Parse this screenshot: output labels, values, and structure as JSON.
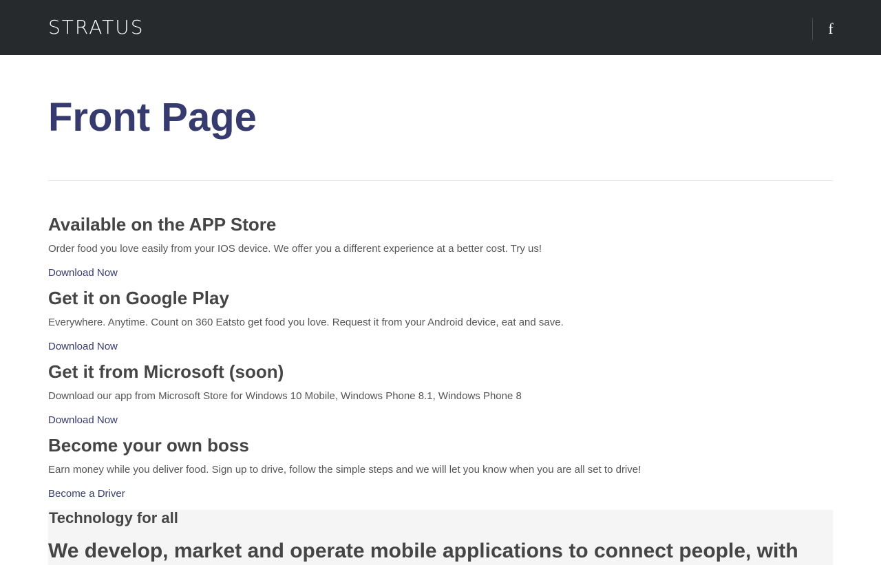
{
  "header": {
    "logo": "STRATUS",
    "facebook_label": "f"
  },
  "page": {
    "title": "Front Page"
  },
  "sections": [
    {
      "heading": "Available on the APP Store",
      "text": "Order food you love easily from your IOS device. We offer you a different experience at a better cost. Try us!",
      "link": "Download Now"
    },
    {
      "heading": "Get it on Google Play",
      "text": "Everywhere. Anytime. Count on 360 Eatsto get food you love. Request it from your Android device, eat and save.",
      "link": "Download Now"
    },
    {
      "heading": "Get it from Microsoft (soon)",
      "text": "Download our app from Microsoft Store for Windows 10 Mobile, Windows Phone 8.1, Windows Phone 8",
      "link": "Download Now"
    },
    {
      "heading": "Become your own boss",
      "text": "Earn money while you deliver food. Sign up to drive, follow the simple steps and we will let you know when you are all set to drive!",
      "link": "Become a Driver"
    }
  ],
  "technology": {
    "title": "Technology for all",
    "subtitle": "We develop, market and operate mobile applications to connect people, with"
  },
  "colors": {
    "header_bg": "#262a2d",
    "title": "#363a6e",
    "link": "#363a6e",
    "heading": "#454545"
  }
}
